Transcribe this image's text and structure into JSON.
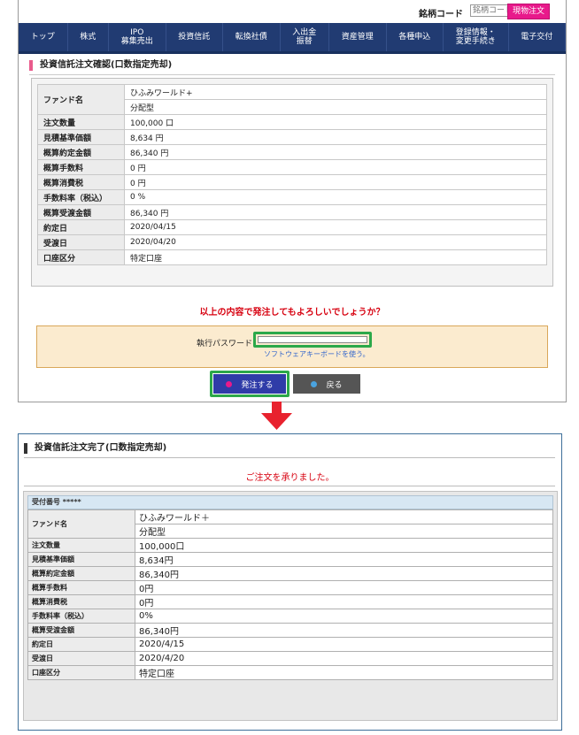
{
  "header": {
    "code_label": "銘柄コード",
    "code_placeholder": "銘柄コード",
    "spot_order_label": "現物注文"
  },
  "nav": {
    "items": [
      "トップ",
      "株式",
      "IPO\n募集売出",
      "投資信託",
      "転換社債",
      "入出金\n振替",
      "資産管理",
      "各種申込",
      "登録情報・\n変更手続き",
      "電子交付"
    ]
  },
  "confirm": {
    "title": "投資信託注文確認(口数指定売却)",
    "fund_label": "ファンド名",
    "fund_name": "ひふみワールド+",
    "fund_type": "分配型",
    "rows": [
      {
        "label": "注文数量",
        "value": "100,000 口"
      },
      {
        "label": "見積基準価額",
        "value": "8,634 円"
      },
      {
        "label": "概算約定金額",
        "value": "86,340 円"
      },
      {
        "label": "概算手数料",
        "value": "0 円"
      },
      {
        "label": "概算消費税",
        "value": "0 円"
      },
      {
        "label": "手数料率（税込）",
        "value": "0 %"
      },
      {
        "label": "概算受渡金額",
        "value": "86,340 円"
      },
      {
        "label": "約定日",
        "value": "2020/04/15"
      },
      {
        "label": "受渡日",
        "value": "2020/04/20"
      },
      {
        "label": "口座区分",
        "value": "特定口座"
      }
    ],
    "question": "以上の内容で発注してもよろしいでしょうか？",
    "password_label": "執行パスワード",
    "password_hint": "ソフトウェアキーボードを使う。",
    "order_button": "発注する",
    "back_button": "戻る"
  },
  "complete": {
    "title": "投資信託注文完了(口数指定売却)",
    "message": "ご注文を承りました。",
    "receipt": "受付番号 *****",
    "fund_label": "ファンド名",
    "fund_name": "ひふみワールド＋",
    "fund_type": "分配型",
    "rows": [
      {
        "label": "注文数量",
        "value": "100,000口"
      },
      {
        "label": "見積基準価額",
        "value": "8,634円"
      },
      {
        "label": "概算約定金額",
        "value": "86,340円"
      },
      {
        "label": "概算手数料",
        "value": "0円"
      },
      {
        "label": "概算消費税",
        "value": "0円"
      },
      {
        "label": "手数料率（税込）",
        "value": "0%"
      },
      {
        "label": "概算受渡金額",
        "value": "86,340円"
      },
      {
        "label": "約定日",
        "value": "2020/4/15"
      },
      {
        "label": "受渡日",
        "value": "2020/4/20"
      },
      {
        "label": "口座区分",
        "value": "特定口座"
      }
    ]
  },
  "colors": {
    "nav_bg": "#213b72",
    "highlight": "#2ca84a",
    "alert_red": "#d7000f",
    "arrow": "#e8222e",
    "spot_button": "#e8198b"
  }
}
